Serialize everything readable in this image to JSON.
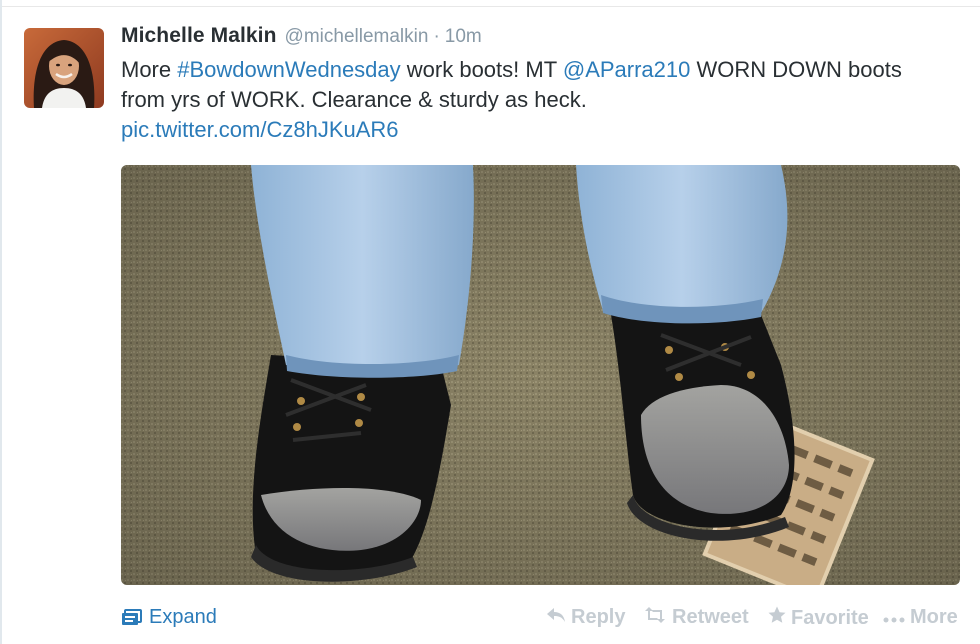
{
  "tweet": {
    "fullname": "Michelle Malkin",
    "screen_name": "@michellemalkin",
    "separator": "·",
    "timestamp": "10m",
    "text": {
      "t1": "More ",
      "hashtag": "#BowdownWednesday",
      "t2": " work boots! MT ",
      "mention": "@AParra210",
      "t3": " WORN DOWN boots from yrs of WORK. Clearance & sturdy as heck.",
      "pic_link": "pic.twitter.com/Cz8hJKuAR6"
    }
  },
  "actions": {
    "expand": "Expand",
    "reply": "Reply",
    "retweet": "Retweet",
    "favorite": "Favorite",
    "more": "More"
  },
  "colors": {
    "link": "#2b7bb9",
    "muted": "#8899a6",
    "action_inactive": "#c5ccd2",
    "text": "#292f33"
  },
  "icons": {
    "expand": "media-card-icon",
    "reply": "reply-arrow-icon",
    "retweet": "retweet-icon",
    "favorite": "star-icon",
    "more": "ellipsis-icon"
  }
}
